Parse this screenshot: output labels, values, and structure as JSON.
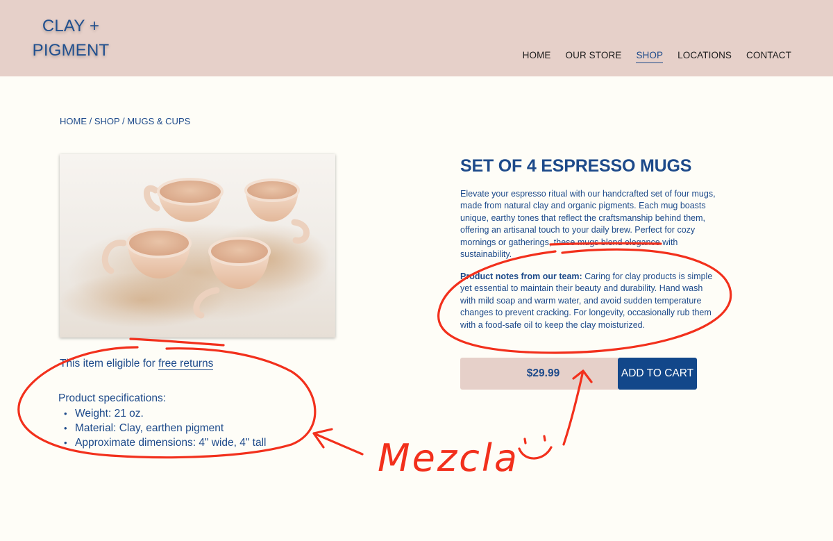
{
  "brand": {
    "line1": "CLAY +",
    "line2": "PIGMENT"
  },
  "nav": [
    {
      "label": "HOME",
      "active": false
    },
    {
      "label": "OUR STORE",
      "active": false
    },
    {
      "label": "SHOP",
      "active": true
    },
    {
      "label": "LOCATIONS",
      "active": false
    },
    {
      "label": "CONTACT",
      "active": false
    }
  ],
  "breadcrumb": "HOME / SHOP / MUGS & CUPS",
  "product": {
    "title": "SET OF 4 ESPRESSO MUGS",
    "description": "Elevate your espresso ritual with our handcrafted set of four mugs, made from natural clay and organic pigments. Each mug boasts unique, earthy tones that reflect the craftsmanship behind them, offering an artisanal touch to your daily brew. Perfect for cozy mornings or gatherings, these mugs blend elegance with sustainability.",
    "notes_heading": "Product notes from our team:",
    "notes_text": " Caring for clay products is simple yet essential to maintain their beauty and durability. Hand wash with mild soap and warm water, and avoid sudden temperature changes to prevent cracking. For longevity, occasionally rub them with a food-safe oil to keep the clay moisturized.",
    "price": "$29.99",
    "add_to_cart": "ADD TO CART"
  },
  "returns": {
    "prefix": "This item eligible for ",
    "link": "free returns"
  },
  "specs": {
    "heading": "Product specifications:",
    "items": [
      "Weight: 21 oz.",
      "Material: Clay, earthen pigment",
      "Approximate dimensions: 4\" wide, 4\" tall"
    ]
  },
  "annotation": {
    "handwriting": "Mezcla"
  },
  "colors": {
    "header_bg": "#e6d0c9",
    "page_bg": "#fefdf7",
    "brand_blue": "#1d4a8a",
    "button_blue": "#12478a",
    "annotation_red": "#f2301c"
  }
}
